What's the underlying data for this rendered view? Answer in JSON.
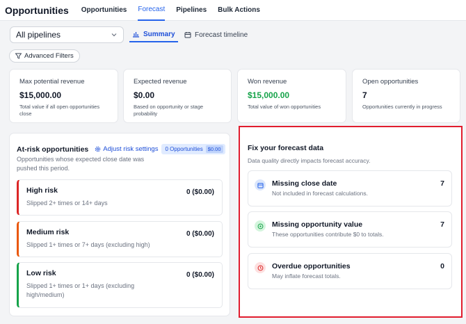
{
  "app": {
    "title": "Opportunities"
  },
  "nav": {
    "tabs": [
      "Opportunities",
      "Forecast",
      "Pipelines",
      "Bulk Actions"
    ],
    "active": "Forecast"
  },
  "toolbar": {
    "pipeline_value": "All pipelines",
    "summary_label": "Summary",
    "timeline_label": "Forecast timeline",
    "advanced_filters_label": "Advanced Filters"
  },
  "stats": [
    {
      "label": "Max potential revenue",
      "value": "$15,000.00",
      "desc": "Total value if all open opportunities close"
    },
    {
      "label": "Expected revenue",
      "value": "$0.00",
      "desc": "Based on opportunity or stage probability"
    },
    {
      "label": "Won revenue",
      "value": "$15,000.00",
      "desc": "Total value of won opportunities"
    },
    {
      "label": "Open opportunities",
      "value": "7",
      "desc": "Opportunities currently in progress"
    }
  ],
  "at_risk": {
    "title": "At-risk opportunities",
    "adjust_label": "Adjust risk settings",
    "badge_label": "0 Opportunities",
    "badge_amount": "$0.00",
    "subtitle": "Opportunities whose expected close date was pushed this period.",
    "items": [
      {
        "name": "High risk",
        "count": "0 ($0.00)",
        "desc": "Slipped 2+ times or 14+ days",
        "color": "#dc2626"
      },
      {
        "name": "Medium risk",
        "count": "0 ($0.00)",
        "desc": "Slipped 1+ times or 7+ days (excluding high)",
        "color": "#ea580c"
      },
      {
        "name": "Low risk",
        "count": "0 ($0.00)",
        "desc": "Slipped 1+ times or 1+ days (excluding high/medium)",
        "color": "#16a34a"
      }
    ]
  },
  "fix_data": {
    "title": "Fix your forecast data",
    "subtitle": "Data quality directly impacts forecast accuracy.",
    "items": [
      {
        "name": "Missing close date",
        "desc": "Not included in forecast calculations.",
        "count": "7",
        "icon": "calendar-icon"
      },
      {
        "name": "Missing opportunity value",
        "desc": "These opportunities contribute $0 to totals.",
        "count": "7",
        "icon": "dollar-icon"
      },
      {
        "name": "Overdue opportunities",
        "desc": "May inflate forecast totals.",
        "count": "0",
        "icon": "clock-icon"
      }
    ]
  },
  "colors": {
    "accent": "#2563eb",
    "won": "#16a34a",
    "highlight_border": "#e11d2e"
  }
}
